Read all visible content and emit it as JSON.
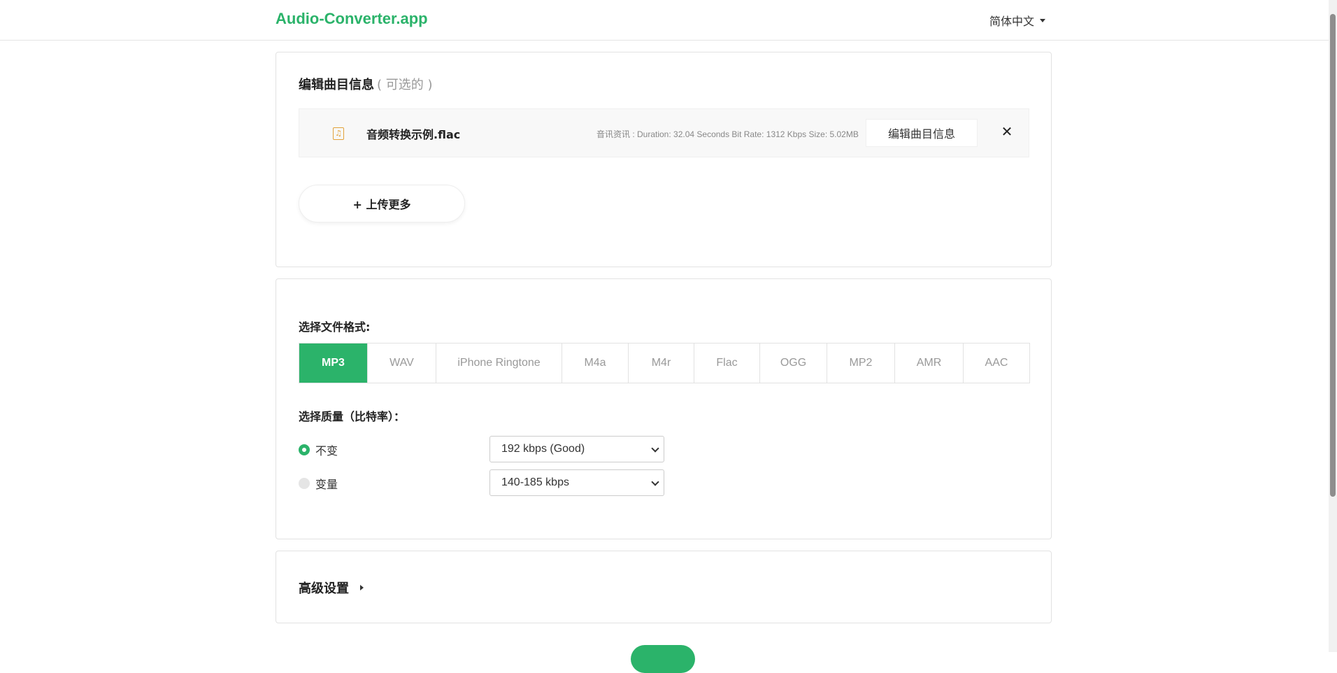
{
  "header": {
    "brand": "Audio-Converter.app",
    "language": "简体中文"
  },
  "edit_section": {
    "title": "编辑曲目信息",
    "optional": "( 可选的 )",
    "file": {
      "icon": "music-file-icon",
      "name": "音频转换示例.flac",
      "info": "音讯资讯 : Duration: 32.04 Seconds Bit Rate: 1312 Kbps Size: 5.02MB",
      "edit_label": "编辑曲目信息"
    },
    "upload_more": "+ 上传更多"
  },
  "format_section": {
    "format_label": "选择文件格式:",
    "formats": [
      "MP3",
      "WAV",
      "iPhone Ringtone",
      "M4a",
      "M4r",
      "Flac",
      "OGG",
      "MP2",
      "AMR",
      "AAC"
    ],
    "selected_format": "MP3",
    "quality_label": "选择质量（比特率）：",
    "quality_options": [
      {
        "label": "不变",
        "selected": true,
        "value": "192 kbps (Good)"
      },
      {
        "label": "变量",
        "selected": false,
        "value": "140-185 kbps"
      }
    ]
  },
  "advanced": {
    "title": "高级设置"
  },
  "colors": {
    "accent": "#2bb36a",
    "file_icon": "#e2a23b"
  }
}
